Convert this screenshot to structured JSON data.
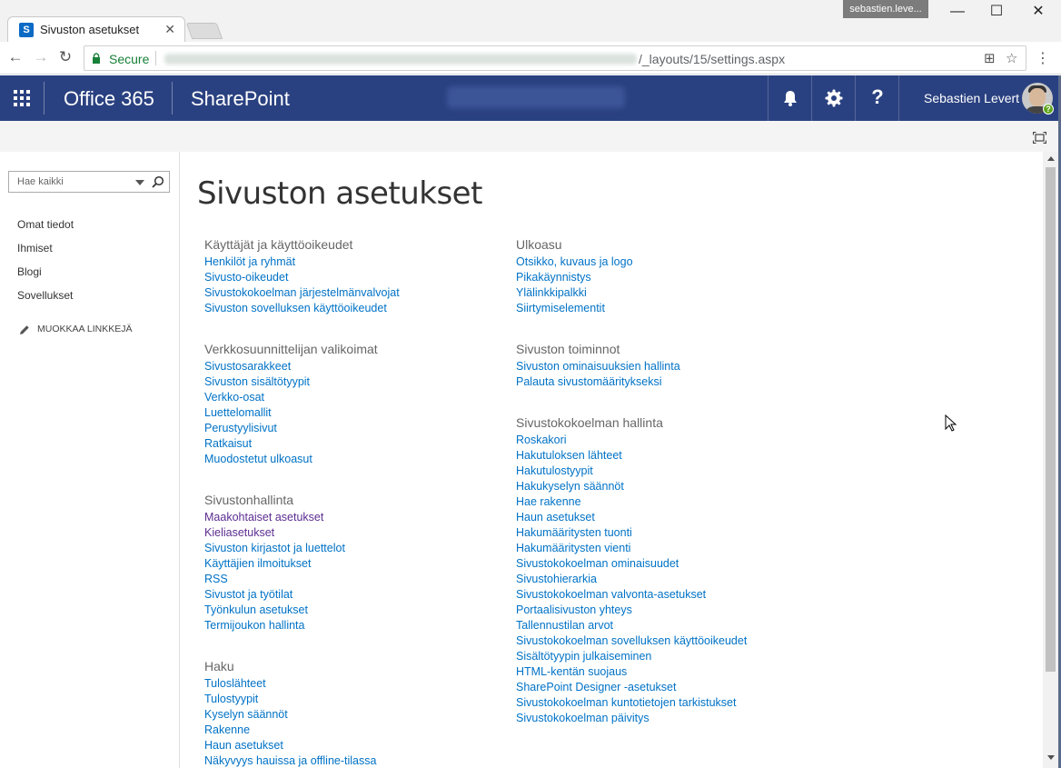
{
  "browser": {
    "tab_title": "Sivuston asetukset",
    "tab_favicon_letter": "S",
    "user_chip": "sebastien.leve...",
    "secure_label": "Secure",
    "url_visible": "/_layouts/15/settings.aspx"
  },
  "suite_bar": {
    "app_launcher": "app-launcher-icon",
    "brand": "Office 365",
    "product": "SharePoint",
    "user_name": "Sebastien Levert",
    "help_label": "?",
    "presence_label": "?",
    "colors": {
      "background": "#2a4181",
      "text": "#ffffff"
    }
  },
  "left_nav": {
    "search_placeholder": "Hae kaikki",
    "items": [
      "Omat tiedot",
      "Ihmiset",
      "Blogi",
      "Sovellukset"
    ],
    "edit_links_label": "MUOKKAA LINKKEJÄ"
  },
  "page": {
    "title": "Sivuston asetukset",
    "link_color": "#0072c6",
    "visited_link_color": "#5c2d91",
    "columns": [
      [
        {
          "title": "Käyttäjät ja käyttöoikeudet",
          "links": [
            "Henkilöt ja ryhmät",
            "Sivusto-oikeudet",
            "Sivustokokoelman järjestelmänvalvojat",
            "Sivuston sovelluksen käyttöoikeudet"
          ]
        },
        {
          "title": "Verkkosuunnittelijan valikoimat",
          "links": [
            "Sivustosarakkeet",
            "Sivuston sisältötyypit",
            "Verkko-osat",
            "Luettelomallit",
            "Perustyylisivut",
            "Ratkaisut",
            "Muodostetut ulkoasut"
          ]
        },
        {
          "title": "Sivustonhallinta",
          "links": [
            "Maakohtaiset asetukset",
            "Kieliasetukset",
            "Sivuston kirjastot ja luettelot",
            "Käyttäjien ilmoitukset",
            "RSS",
            "Sivustot ja työtilat",
            "Työnkulun asetukset",
            "Termijoukon hallinta"
          ]
        },
        {
          "title": "Haku",
          "links": [
            "Tuloslähteet",
            "Tulostyypit",
            "Kyselyn säännöt",
            "Rakenne",
            "Haun asetukset",
            "Näkyvyys hauissa ja offline-tilassa"
          ]
        }
      ],
      [
        {
          "title": "Ulkoasu",
          "links": [
            "Otsikko, kuvaus ja logo",
            "Pikakäynnistys",
            "Ylälinkkipalkki",
            "Siirtymiselementit"
          ]
        },
        {
          "title": "Sivuston toiminnot",
          "links": [
            "Sivuston ominaisuuksien hallinta",
            "Palauta sivustomääritykseksi"
          ]
        },
        {
          "title": "Sivustokokoelman hallinta",
          "links": [
            "Roskakori",
            "Hakutuloksen lähteet",
            "Hakutulostyypit",
            "Hakukyselyn säännöt",
            "Hae rakenne",
            "Haun asetukset",
            "Hakumääritysten tuonti",
            "Hakumääritysten vienti",
            "Sivustokokoelman ominaisuudet",
            "Sivustohierarkia",
            "Sivustokokoelman valvonta-asetukset",
            "Portaalisivuston yhteys",
            "Tallennustilan arvot",
            "Sivustokokoelman sovelluksen käyttöoikeudet",
            "Sisältötyypin julkaiseminen",
            "HTML-kentän suojaus",
            "SharePoint Designer -asetukset",
            "Sivustokokoelman kuntotietojen tarkistukset",
            "Sivustokokoelman päivitys"
          ]
        }
      ]
    ]
  }
}
